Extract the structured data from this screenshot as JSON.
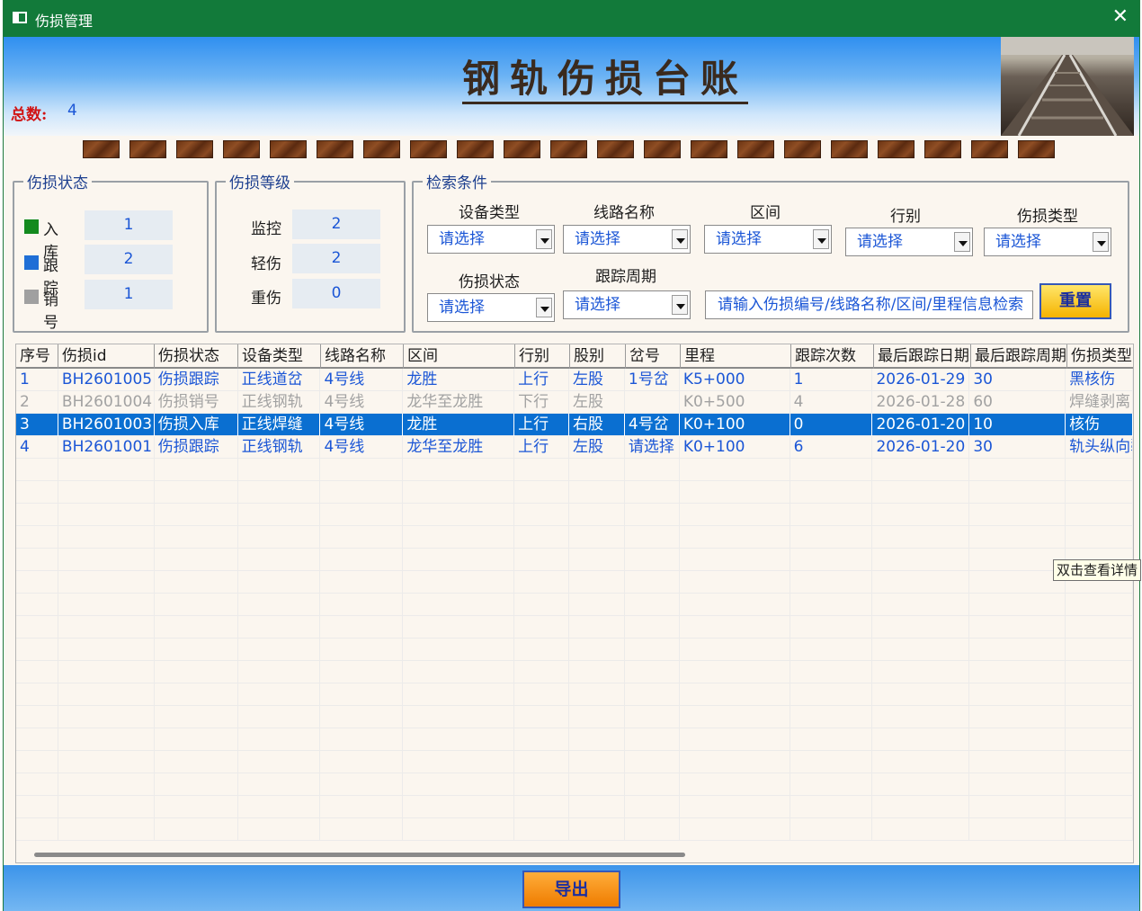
{
  "window": {
    "title": "伤损管理",
    "close_glyph": "✕"
  },
  "header": {
    "heading": "钢轨伤损台账",
    "total_label": "总数:",
    "total_value": "4"
  },
  "status_panel": {
    "legend": "伤损状态",
    "items": [
      {
        "label": "入库",
        "value": "1",
        "color": "#138a1e"
      },
      {
        "label": "跟踪",
        "value": "2",
        "color": "#1f6fd6"
      },
      {
        "label": "销号",
        "value": "1",
        "color": "#a0a0a0"
      }
    ]
  },
  "level_panel": {
    "legend": "伤损等级",
    "items": [
      {
        "label": "监控",
        "value": "2"
      },
      {
        "label": "轻伤",
        "value": "2"
      },
      {
        "label": "重伤",
        "value": "0"
      }
    ]
  },
  "search_panel": {
    "legend": "检索条件",
    "filters": [
      {
        "label": "设备类型",
        "value": "请选择"
      },
      {
        "label": "线路名称",
        "value": "请选择"
      },
      {
        "label": "区间",
        "value": "请选择"
      },
      {
        "label": "行别",
        "value": "请选择"
      },
      {
        "label": "伤损类型",
        "value": "请选择"
      },
      {
        "label": "伤损状态",
        "value": "请选择"
      },
      {
        "label": "跟踪周期",
        "value": "请选择"
      }
    ],
    "search_placeholder": "请输入伤损编号/线路名称/区间/里程信息检索",
    "reset_label": "重置"
  },
  "table": {
    "columns": [
      "序号",
      "伤损id",
      "伤损状态",
      "设备类型",
      "线路名称",
      "区间",
      "行别",
      "股别",
      "岔号",
      "里程",
      "跟踪次数",
      "最后跟踪日期",
      "最后跟踪周期",
      "伤损类型"
    ],
    "rows": [
      {
        "style": "blue",
        "cells": [
          "1",
          "BH2601005",
          "伤损跟踪",
          "正线道岔",
          "4号线",
          "龙胜",
          "上行",
          "左股",
          "1号岔",
          "K5+000",
          "1",
          "2026-01-29",
          "30",
          "黑核伤"
        ]
      },
      {
        "style": "grey",
        "cells": [
          "2",
          "BH2601004",
          "伤损销号",
          "正线钢轨",
          "4号线",
          "龙华至龙胜",
          "下行",
          "左股",
          "",
          "K0+500",
          "4",
          "2026-01-28",
          "60",
          "焊缝剥离"
        ]
      },
      {
        "style": "selected",
        "cells": [
          "3",
          "BH2601003",
          "伤损入库",
          "正线焊缝",
          "4号线",
          "龙胜",
          "上行",
          "右股",
          "4号岔",
          "K0+100",
          "0",
          "2026-01-20",
          "10",
          "核伤"
        ]
      },
      {
        "style": "blue",
        "cells": [
          "4",
          "BH2601001",
          "伤损跟踪",
          "正线钢轨",
          "4号线",
          "龙华至龙胜",
          "上行",
          "左股",
          "请选择",
          "K0+100",
          "6",
          "2026-01-20",
          "30",
          "轨头纵向裂纹"
        ]
      }
    ],
    "tooltip": "双击查看详情"
  },
  "footer": {
    "export_label": "导出"
  }
}
